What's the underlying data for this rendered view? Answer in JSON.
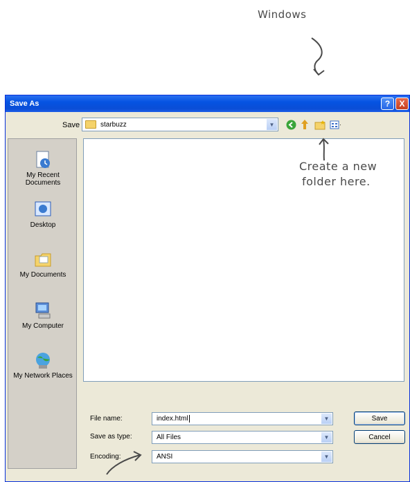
{
  "annotations": {
    "windows_label": "Windows",
    "create_note_line1": "Create a new",
    "create_note_line2": "folder here."
  },
  "window": {
    "title": "Save As",
    "help_glyph": "?",
    "close_glyph": "X"
  },
  "toolbar": {
    "save_in_label": "Save in:",
    "save_in_value": "starbuzz",
    "icons": [
      "back-icon",
      "up-folder-icon",
      "new-folder-icon",
      "views-menu-icon"
    ]
  },
  "places": [
    {
      "label": "My Recent Documents",
      "icon": "recent-documents-icon"
    },
    {
      "label": "Desktop",
      "icon": "desktop-icon"
    },
    {
      "label": "My Documents",
      "icon": "my-documents-icon"
    },
    {
      "label": "My Computer",
      "icon": "my-computer-icon"
    },
    {
      "label": "My Network Places",
      "icon": "network-places-icon"
    }
  ],
  "form": {
    "file_name_label": "File name:",
    "file_name_value": "index.html",
    "save_as_type_label": "Save as type:",
    "save_as_type_value": "All Files",
    "encoding_label": "Encoding:",
    "encoding_value": "ANSI"
  },
  "buttons": {
    "save": "Save",
    "cancel": "Cancel"
  },
  "colors": {
    "title_bar": "#0553e2",
    "dialog_bg": "#ece9d8",
    "places_bg": "#d4d0c8"
  }
}
